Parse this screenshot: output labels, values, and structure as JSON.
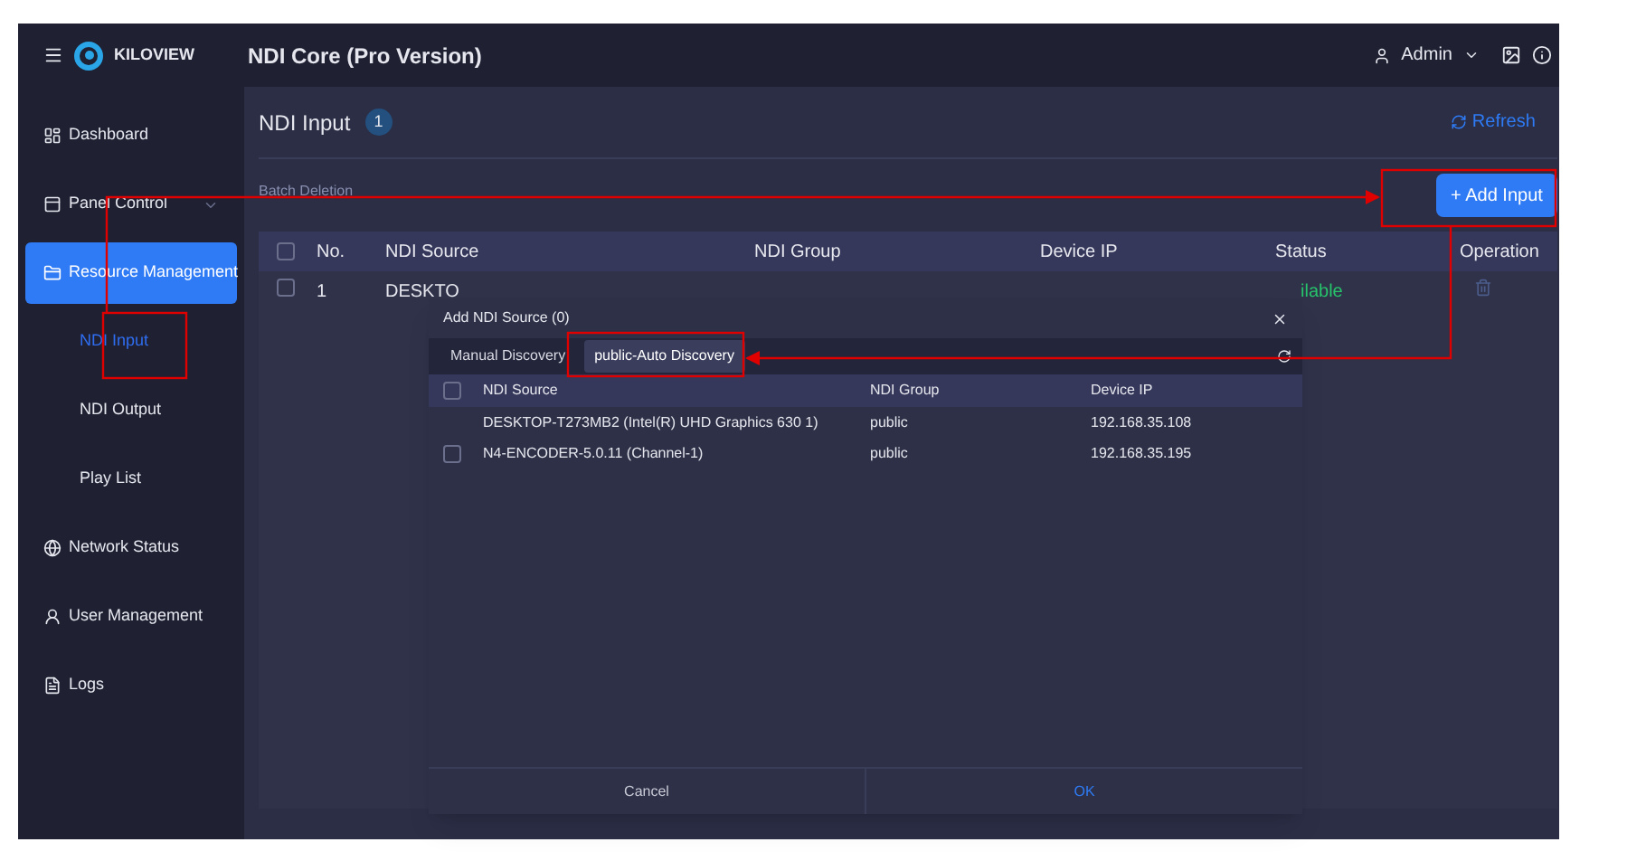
{
  "header": {
    "logo": "KILOVIEW",
    "title": "NDI Core (Pro Version)",
    "user": "Admin"
  },
  "sidebar": {
    "items": [
      {
        "label": "Dashboard",
        "selected": false
      },
      {
        "label": "Panel Control",
        "selected": false,
        "expanded": false
      },
      {
        "label": "Resource Management",
        "selected": true,
        "expanded": true,
        "children": [
          {
            "label": "NDI Input",
            "selected": true
          },
          {
            "label": "NDI Output",
            "selected": false
          },
          {
            "label": "Play List",
            "selected": false
          }
        ]
      },
      {
        "label": "Network Status",
        "selected": false
      },
      {
        "label": "User Management",
        "selected": false
      },
      {
        "label": "Logs",
        "selected": false
      }
    ]
  },
  "page": {
    "title": "NDI Input",
    "count": "1",
    "refresh": "Refresh",
    "batch_deletion": "Batch Deletion",
    "add_button": "+ Add Input"
  },
  "table": {
    "all_checked": false,
    "columns": [
      "No.",
      "NDI Source",
      "NDI Group",
      "Device IP",
      "Status",
      "Operation"
    ],
    "rows": [
      {
        "no": "1",
        "source": "DESKTO",
        "status": "ilable",
        "checked": false
      }
    ]
  },
  "dialog": {
    "title": "Add NDI Source (0)",
    "tabs": [
      {
        "label": "Manual Discovery",
        "selected": false
      },
      {
        "label": "public-Auto Discovery",
        "selected": true
      }
    ],
    "all_checked": false,
    "columns": [
      "NDI Source",
      "NDI Group",
      "Device IP"
    ],
    "rows": [
      {
        "source": "DESKTOP-T273MB2 (Intel(R) UHD Graphics 630 1)",
        "group": "public",
        "ip": "192.168.35.108",
        "kind": "plain"
      },
      {
        "source": "N4-ENCODER-5.0.11 (Channel-1)",
        "group": "public",
        "ip": "192.168.35.195",
        "kind": "checkbox",
        "checked": false
      }
    ],
    "cancel": "Cancel",
    "ok": "OK"
  }
}
